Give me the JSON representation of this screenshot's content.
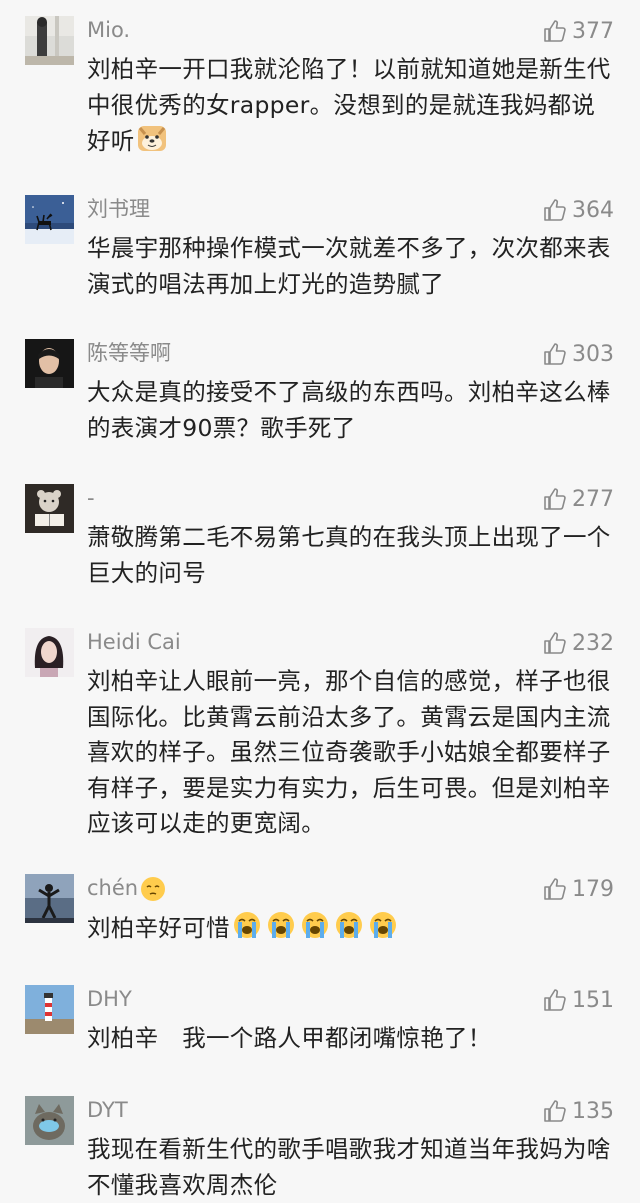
{
  "comments": [
    {
      "user": "Mio.",
      "likes": "377",
      "text": "刘柏辛一开口我就沦陷了！以前就知道她是新生代中很优秀的女rapper。没想到的是就连我妈都说好听",
      "trailing_emoji": "doge-emoji",
      "avatar": "person-standing-avatar"
    },
    {
      "user": "刘书理",
      "likes": "364",
      "text": "华晨宇那种操作模式一次就差不多了，次次都来表演式的唱法再加上灯光的造势腻了",
      "avatar": "deer-night-avatar"
    },
    {
      "user": "陈等等啊",
      "likes": "303",
      "text": "大众是真的接受不了高级的东西吗。刘柏辛这么棒的表演才90票？歌手死了",
      "avatar": "man-portrait-avatar"
    },
    {
      "user": "-",
      "likes": "277",
      "text": "萧敬腾第二毛不易第七真的在我头顶上出现了一个巨大的问号",
      "avatar": "bear-reading-avatar"
    },
    {
      "user": "Heidi Cai",
      "likes": "232",
      "text": "刘柏辛让人眼前一亮，那个自信的感觉，样子也很国际化。比黄霄云前沿太多了。黄霄云是国内主流喜欢的样子。虽然三位奇袭歌手小姑娘全都要样子有样子，要是实力有实力，后生可畏。但是刘柏辛应该可以走的更宽阔。",
      "avatar": "woman-portrait-avatar"
    },
    {
      "user": "chén",
      "user_emoji": "pensive-emoji",
      "likes": "179",
      "text": "刘柏辛好可惜",
      "crying_emoji_count": 5,
      "avatar": "silhouette-sky-avatar"
    },
    {
      "user": "DHY",
      "likes": "151",
      "text": "刘柏辛　我一个路人甲都闭嘴惊艳了！",
      "avatar": "lighthouse-avatar"
    },
    {
      "user": "DYT",
      "likes": "135",
      "text": "我现在看新生代的歌手唱歌我才知道当年我妈为啥不懂我喜欢周杰伦",
      "avatar": "cat-avatar"
    }
  ],
  "colors": {
    "background": "#f7f7f7",
    "username": "#8a8a8a",
    "text": "#222222",
    "like": "#8a8a8a"
  }
}
